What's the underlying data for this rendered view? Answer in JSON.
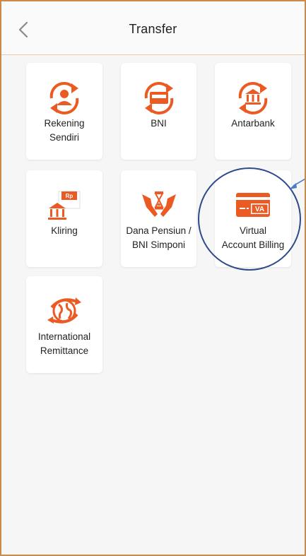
{
  "header": {
    "title": "Transfer"
  },
  "tiles": [
    {
      "line1": "Rekening",
      "line2": "Sendiri"
    },
    {
      "line1": "BNI",
      "line2": ""
    },
    {
      "line1": "Antarbank",
      "line2": ""
    },
    {
      "line1": "Kliring",
      "line2": "",
      "badge": "Rp"
    },
    {
      "line1": "Dana Pensiun /",
      "line2": "BNI Simponi"
    },
    {
      "line1": "Virtual",
      "line2": "Account Billing",
      "badge": "VA"
    },
    {
      "line1": "International",
      "line2": "Remittance"
    }
  ],
  "icons": {
    "back": "chevron-left-icon",
    "rekening_sendiri": "user-transfer-icon",
    "bni": "bank-card-transfer-icon",
    "antarbank": "bank-building-transfer-icon",
    "kliring": "bank-rp-icon",
    "dana_pensiun": "hands-hourglass-icon",
    "virtual_account": "va-card-icon",
    "international": "globe-transfer-icon"
  },
  "colors": {
    "accent": "#ec5a24",
    "highlight": "#2d4a8a",
    "arrow": "#4a7bc9"
  }
}
